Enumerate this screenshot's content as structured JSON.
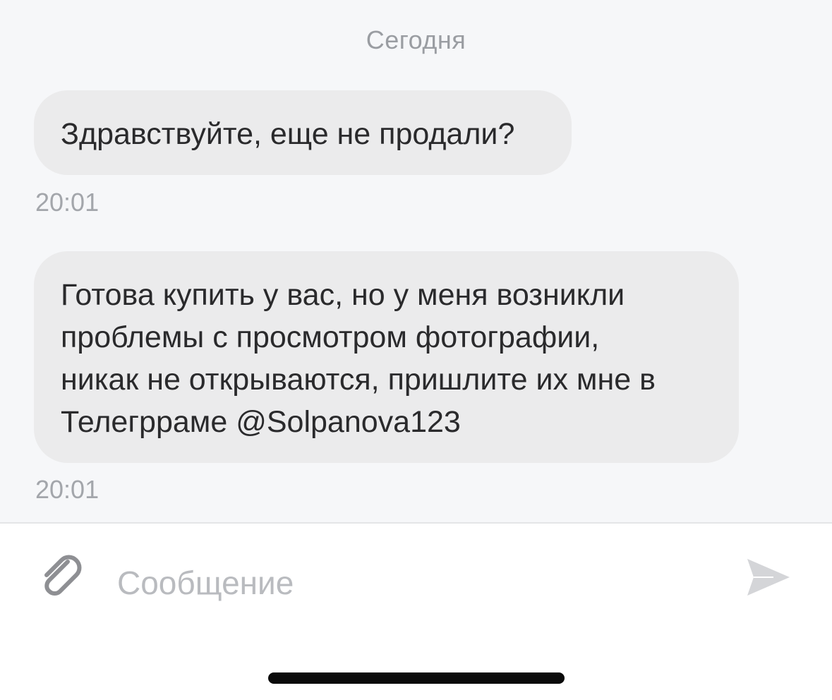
{
  "chat": {
    "date_separator": "Сегодня",
    "messages": [
      {
        "text": "Здравствуйте, еще не продали?",
        "time": "20:01"
      },
      {
        "text": "Готова купить у вас, но у меня возникли\nпроблемы с просмотром фотографии,\nникак не открываются, пришлите их мне в\nТелегрраме @Solpanova123",
        "time": "20:01"
      }
    ]
  },
  "composer": {
    "placeholder": "Сообщение",
    "attach_icon": "paperclip-icon",
    "send_icon": "send-icon"
  },
  "colors": {
    "chat_background": "#f6f7f9",
    "bubble_background": "#ebebec",
    "muted_text": "#a3a6ab",
    "icon_gray": "#8e8f93"
  }
}
